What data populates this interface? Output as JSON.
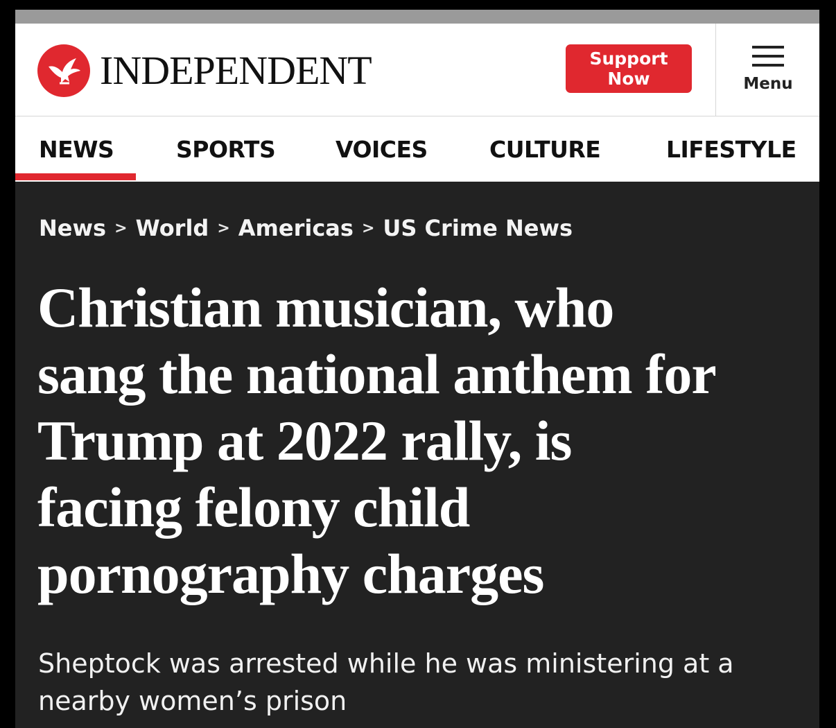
{
  "brand": {
    "name": "INDEPENDENT",
    "accent_color": "#e0282f",
    "logo_icon": "eagle-icon"
  },
  "header": {
    "support_label": "Support Now",
    "menu_label": "Menu",
    "menu_icon": "hamburger-icon"
  },
  "nav": {
    "items": [
      {
        "label": "NEWS",
        "active": true
      },
      {
        "label": "SPORTS",
        "active": false
      },
      {
        "label": "VOICES",
        "active": false
      },
      {
        "label": "CULTURE",
        "active": false
      },
      {
        "label": "LIFESTYLE",
        "active": false
      }
    ]
  },
  "breadcrumb": {
    "items": [
      "News",
      "World",
      "Americas",
      "US Crime News"
    ],
    "separator": ">"
  },
  "article": {
    "headline_lines": [
      "Christian musician, who",
      "sang the national anthem for",
      "Trump at 2022 rally, is",
      "facing felony child",
      "pornography charges"
    ],
    "subhead_lines": [
      "Sheptock was arrested while he was ministering at a",
      "nearby women’s prison"
    ]
  }
}
